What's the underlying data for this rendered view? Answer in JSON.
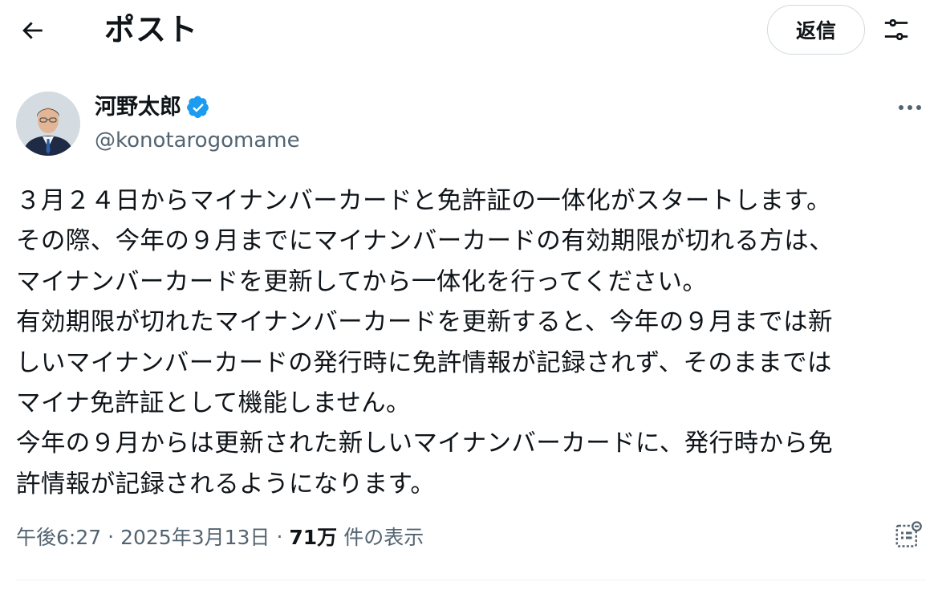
{
  "header": {
    "back_icon": "arrow-left-icon",
    "title": "ポスト",
    "reply_label": "返信",
    "settings_icon": "sliders-icon"
  },
  "post": {
    "author": {
      "name": "河野太郎",
      "handle": "@konotarogomame",
      "verified": true,
      "verified_color": "#1d9bf0"
    },
    "more_icon": "more-horizontal-icon",
    "text_lines": [
      "３月２４日からマイナンバーカードと免許証の一体化がスタートします。",
      "その際、今年の９月までにマイナンバーカードの有効期限が切れる方は、",
      "マイナンバーカードを更新してから一体化を行ってください。",
      "有効期限が切れたマイナンバーカードを更新すると、今年の９月までは新",
      "しいマイナンバーカードの発行時に免許情報が記録されず、そのままでは",
      "マイナ免許証として機能しません。",
      "今年の９月からは更新された新しいマイナンバーカードに、発行時から免",
      "許情報が記録されるようになります。"
    ],
    "meta": {
      "time": "午後6:27",
      "separator": "·",
      "date": "2025年3月13日",
      "views_count": "71万",
      "views_label": "件の表示"
    },
    "analytics_icon": "analytics-icon"
  },
  "colors": {
    "text_primary": "#0f1419",
    "text_secondary": "#536471",
    "border": "#cfd9de",
    "accent": "#1d9bf0"
  }
}
